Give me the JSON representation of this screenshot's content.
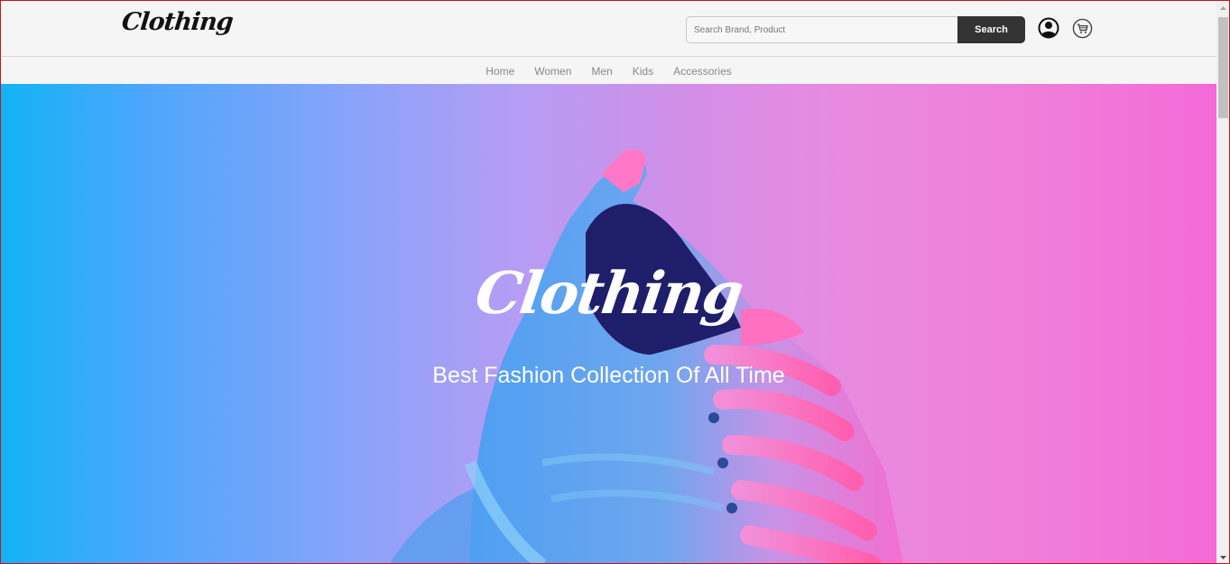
{
  "header": {
    "logo_text": "Clothing",
    "search": {
      "placeholder": "Search Brand, Product",
      "value": ""
    },
    "search_button_label": "Search",
    "icons": {
      "user": "user-account-icon",
      "cart": "shopping-cart-icon"
    }
  },
  "nav": {
    "items": [
      {
        "label": "Home"
      },
      {
        "label": "Women"
      },
      {
        "label": "Men"
      },
      {
        "label": "Kids"
      },
      {
        "label": "Accessories"
      }
    ]
  },
  "hero": {
    "logo_text": "Clothing",
    "tagline": "Best Fashion Collection Of All Time",
    "colors": {
      "left": "#12b3f5",
      "right": "#f36ad7"
    }
  },
  "theme": {
    "accent_dark": "#333333",
    "frame_border": "#c4161c"
  }
}
